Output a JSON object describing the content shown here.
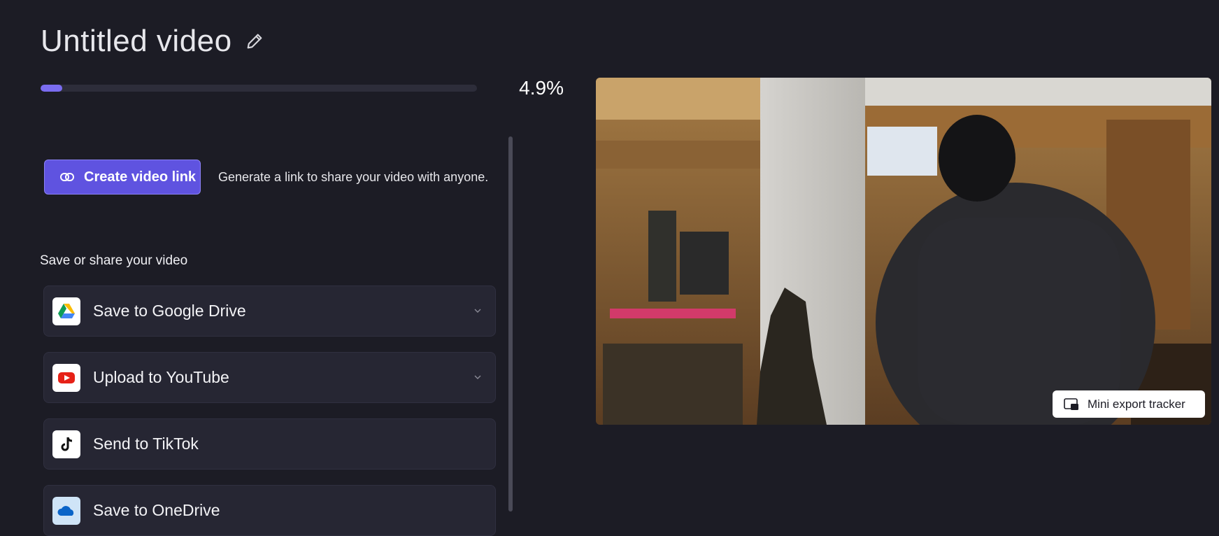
{
  "header": {
    "title": "Untitled video",
    "edit_icon": "pencil-icon"
  },
  "export": {
    "progress_text": "4.9%",
    "progress_value": 4.9
  },
  "link": {
    "button_label": "Create video link",
    "button_icon": "link-icon",
    "description": "Generate a link to share your video with anyone."
  },
  "share": {
    "section_label": "Save or share your video",
    "items": [
      {
        "label": "Save to Google Drive",
        "icon": "google-drive-icon",
        "expandable": true
      },
      {
        "label": "Upload to YouTube",
        "icon": "youtube-icon",
        "expandable": true
      },
      {
        "label": "Send to TikTok",
        "icon": "tiktok-icon",
        "expandable": false
      },
      {
        "label": "Save to OneDrive",
        "icon": "onedrive-icon",
        "expandable": false
      }
    ]
  },
  "preview": {
    "tracker_label": "Mini export tracker",
    "tracker_icon": "picture-in-picture-icon"
  },
  "colors": {
    "background": "#1c1c25",
    "accent": "#5f53e0",
    "progress": "#7a6cf0",
    "card": "#262633"
  }
}
